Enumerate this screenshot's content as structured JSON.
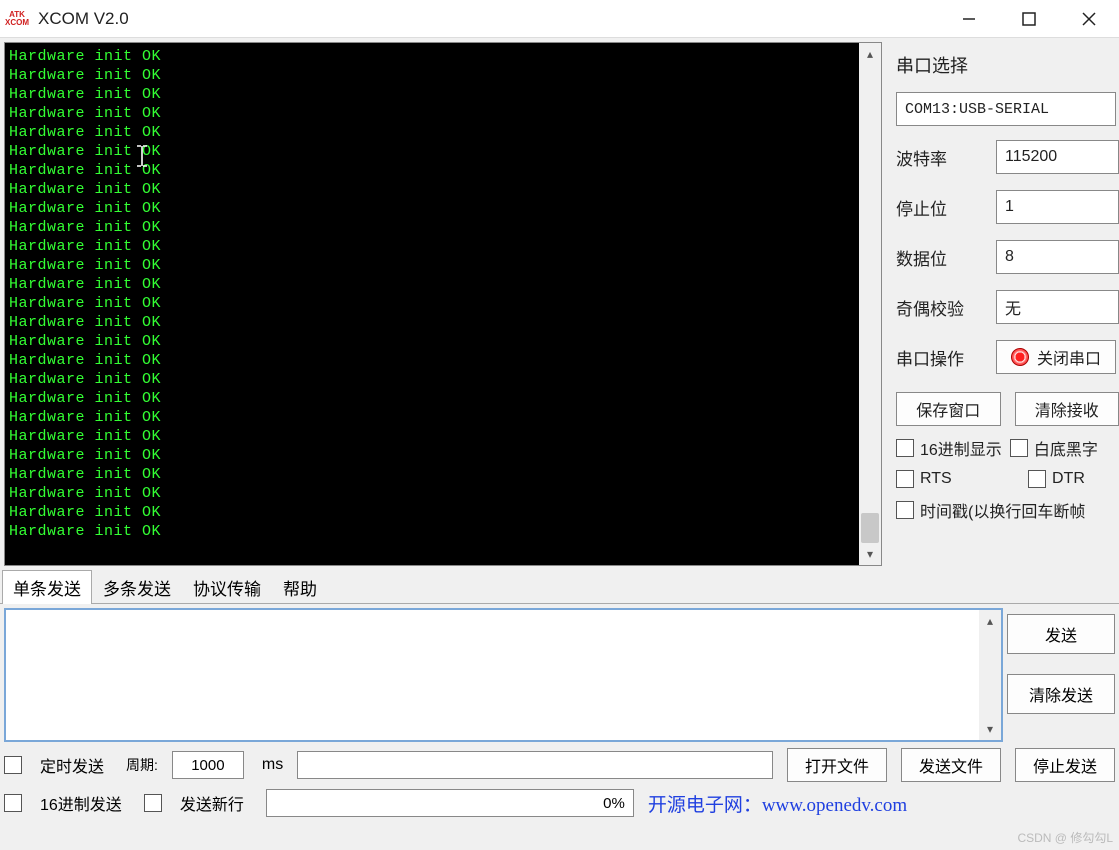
{
  "window": {
    "icon_top": "ATK",
    "icon_bottom": "XCOM",
    "title": "XCOM V2.0"
  },
  "terminal": {
    "line": "Hardware init OK",
    "count": 26
  },
  "side": {
    "port_label": "串口选择",
    "port_value": "COM13:USB-SERIAL",
    "baud_label": "波特率",
    "baud_value": "115200",
    "stop_label": "停止位",
    "stop_value": "1",
    "data_label": "数据位",
    "data_value": "8",
    "parity_label": "奇偶校验",
    "parity_value": "无",
    "portop_label": "串口操作",
    "close_port": "关闭串口",
    "save_win": "保存窗口",
    "clear_recv": "清除接收",
    "hex_disp": "16进制显示",
    "bw_disp": "白底黑字",
    "rts": "RTS",
    "dtr": "DTR",
    "timestamp": "时间戳(以换行回车断帧"
  },
  "tabs": {
    "single": "单条发送",
    "multi": "多条发送",
    "proto": "协议传输",
    "help": "帮助"
  },
  "send": {
    "send_btn": "发送",
    "clear_btn": "清除发送"
  },
  "footer": {
    "timed": "定时发送",
    "period_label": "周期:",
    "period_value": "1000",
    "period_unit": "ms",
    "open_file": "打开文件",
    "send_file": "发送文件",
    "stop_send": "停止发送",
    "hex_send": "16进制发送",
    "send_newline": "发送新行",
    "progress": "0%",
    "link_text": "开源电子网：www.openedv.com"
  },
  "watermark": "CSDN @ 修勾勾L"
}
